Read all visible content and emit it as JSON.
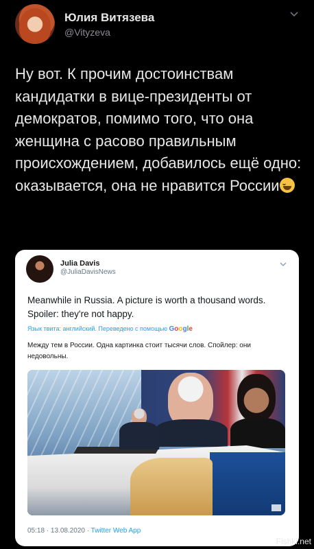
{
  "header": {
    "name": "Юлия Витязева",
    "handle": "@Vityzeva"
  },
  "tweet": {
    "text": "Ну вот. К прочим достоинствам кандидатки в вице-президенты от демократов, помимо того, что она женщина с расово правильным происхождением, добавилось ещё одно: оказывается, она не нравится России",
    "emoji": "face-with-tears-of-joy"
  },
  "quoted": {
    "name": "Julia Davis",
    "handle": "@JuliaDavisNews",
    "text": "Meanwhile in Russia. A picture is worth a thousand words. Spoiler: they're not happy.",
    "translate_note": "Язык твита: английский. Переведено с помощью",
    "translate_service": "Google",
    "translated_text": "Между тем в России. Одна картинка стоит тысячи слов. Спойлер: они недовольны.",
    "timestamp": "05:18 · 13.08.2020 · ",
    "app": "Twitter Web App"
  },
  "watermark": "Fishki.net",
  "colors": {
    "background": "#000000",
    "card": "#ffffff",
    "link": "#1da1f2",
    "muted": "#657786"
  }
}
